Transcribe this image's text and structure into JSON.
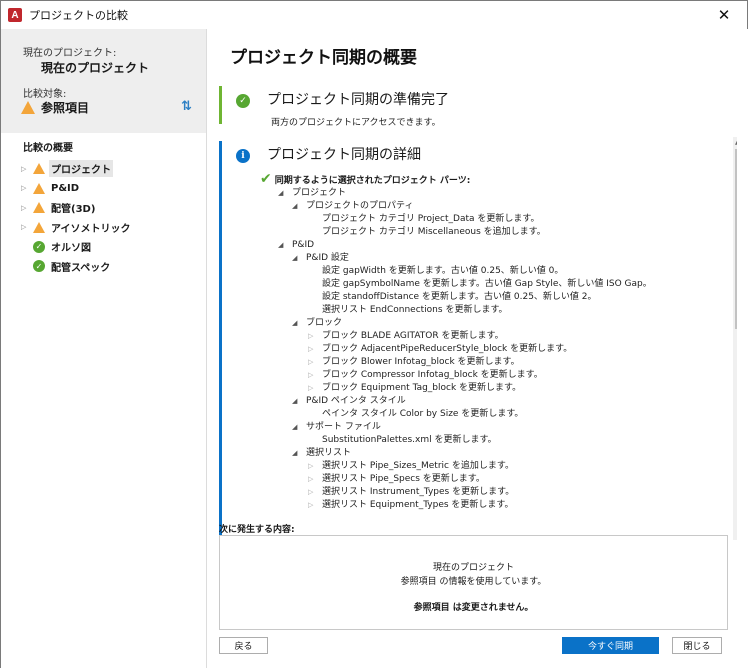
{
  "window": {
    "title": "プロジェクトの比較",
    "close_glyph": "✕",
    "app_icon_letter": "A"
  },
  "left": {
    "current_label": "現在のプロジェクト:",
    "current_value": "現在のプロジェクト",
    "compare_label": "比較対象:",
    "compare_value": "参照項目",
    "overview_title": "比較の概要",
    "tree": [
      {
        "label": "プロジェクト",
        "status": "warning",
        "expandable": true,
        "selected": true
      },
      {
        "label": "P&ID",
        "status": "warning",
        "expandable": true
      },
      {
        "label": "配管(3D)",
        "status": "warning",
        "expandable": true
      },
      {
        "label": "アイソメトリック",
        "status": "warning",
        "expandable": true
      },
      {
        "label": "オルソ図",
        "status": "ok",
        "expandable": false
      },
      {
        "label": "配管スペック",
        "status": "ok",
        "expandable": false
      }
    ]
  },
  "main": {
    "title": "プロジェクト同期の概要",
    "ready": {
      "title": "プロジェクト同期の準備完了",
      "subtitle": "両方のプロジェクトにアクセスできます。"
    },
    "detail": {
      "title": "プロジェクト同期の詳細",
      "selected_header": "同期するように選択されたプロジェクト パーツ:",
      "lines": [
        {
          "text": "プロジェクト",
          "indent": 0,
          "toggle": "open"
        },
        {
          "text": "プロジェクトのプロパティ",
          "indent": 1,
          "toggle": "open"
        },
        {
          "text": "プロジェクト カテゴリ Project_Data を更新します。",
          "indent": 2,
          "toggle": "none"
        },
        {
          "text": "プロジェクト カテゴリ Miscellaneous を追加します。",
          "indent": 2,
          "toggle": "none"
        },
        {
          "text": "P&ID",
          "indent": 0,
          "toggle": "open"
        },
        {
          "text": "P&ID 設定",
          "indent": 1,
          "toggle": "open"
        },
        {
          "text": "設定 gapWidth を更新します。古い値 0.25、新しい値 0。",
          "indent": 2,
          "toggle": "none"
        },
        {
          "text": "設定 gapSymbolName を更新します。古い値 Gap Style、新しい値 ISO Gap。",
          "indent": 2,
          "toggle": "none"
        },
        {
          "text": "設定 standoffDistance を更新します。古い値 0.25、新しい値 2。",
          "indent": 2,
          "toggle": "none"
        },
        {
          "text": "選択リスト EndConnections を更新します。",
          "indent": 2,
          "toggle": "none"
        },
        {
          "text": "ブロック",
          "indent": 1,
          "toggle": "open"
        },
        {
          "text": "ブロック BLADE AGITATOR を更新します。",
          "indent": 2,
          "toggle": "closed"
        },
        {
          "text": "ブロック AdjacentPipeReducerStyle_block を更新します。",
          "indent": 2,
          "toggle": "closed"
        },
        {
          "text": "ブロック Blower Infotag_block を更新します。",
          "indent": 2,
          "toggle": "closed"
        },
        {
          "text": "ブロック Compressor Infotag_block を更新します。",
          "indent": 2,
          "toggle": "closed"
        },
        {
          "text": "ブロック Equipment Tag_block を更新します。",
          "indent": 2,
          "toggle": "closed"
        },
        {
          "text": "P&ID ペインタ スタイル",
          "indent": 1,
          "toggle": "open"
        },
        {
          "text": "ペインタ スタイル Color by Size を更新します。",
          "indent": 2,
          "toggle": "none"
        },
        {
          "text": "サポート ファイル",
          "indent": 1,
          "toggle": "open"
        },
        {
          "text": "SubstitutionPalettes.xml を更新します。",
          "indent": 2,
          "toggle": "none"
        },
        {
          "text": "選択リスト",
          "indent": 1,
          "toggle": "open"
        },
        {
          "text": "選択リスト Pipe_Sizes_Metric を追加します。",
          "indent": 2,
          "toggle": "closed"
        },
        {
          "text": "選択リスト Pipe_Specs を更新します。",
          "indent": 2,
          "toggle": "closed"
        },
        {
          "text": "選択リスト Instrument_Types を更新します。",
          "indent": 2,
          "toggle": "closed"
        },
        {
          "text": "選択リスト Equipment_Types を更新します。",
          "indent": 2,
          "toggle": "closed"
        }
      ]
    },
    "next": {
      "label": "次に発生する内容:",
      "line1": "現在のプロジェクト",
      "line2": "参照項目 の情報を使用しています。",
      "line3": "参照項目 は変更されません。"
    },
    "buttons": {
      "back": "戻る",
      "sync": "今すぐ同期",
      "close": "閉じる"
    }
  },
  "colors": {
    "accent": "#0a72c8",
    "ok": "#57a732",
    "warning": "#f3a53a",
    "ready_bar": "#6fb533"
  }
}
